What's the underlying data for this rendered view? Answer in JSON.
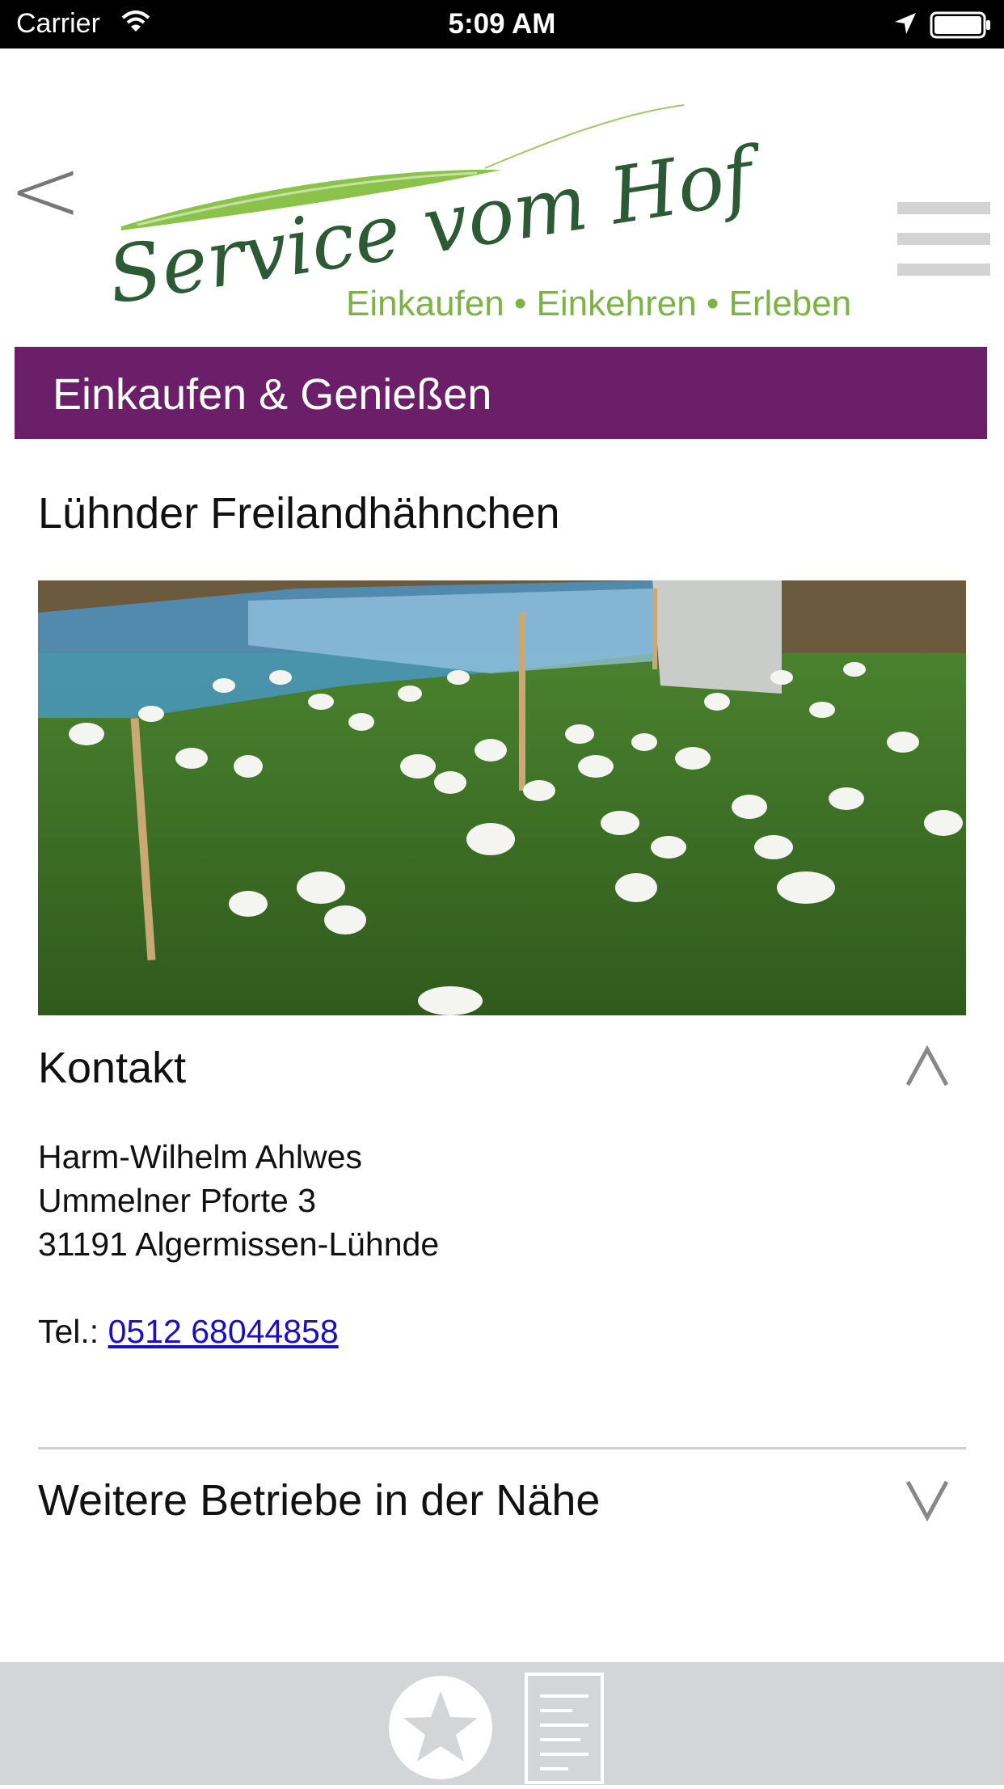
{
  "status_bar": {
    "carrier": "Carrier",
    "time": "5:09 AM",
    "icons": [
      "wifi-icon",
      "location-arrow-icon",
      "battery-icon"
    ]
  },
  "header": {
    "back_label": "<",
    "logo": {
      "line1": "Service vom Hof",
      "tagline": "Einkaufen • Einkehren • Erleben",
      "colors": {
        "script": "#2b5a34",
        "tagline": "#7cb342",
        "leaf": "#8bc34a"
      }
    },
    "menu_icon": "hamburger-menu-icon"
  },
  "category": {
    "label": "Einkaufen & Genießen",
    "color": "#6a1f68"
  },
  "listing": {
    "title": "Lühnder Freilandhähnchen",
    "photo_icon": "chicken-farm-photo"
  },
  "contact": {
    "heading": "Kontakt",
    "expanded_icon": "chevron-up-icon",
    "name": "Harm-Wilhelm Ahlwes",
    "street": "Ummelner Pforte 3",
    "city": "31191 Algermissen-Lühnde",
    "phone_label": "Tel.:",
    "phone": "0512 68044858",
    "link_color": "#1a0dcc"
  },
  "nearby": {
    "heading": "Weitere Betriebe in der Nähe",
    "collapsed_icon": "chevron-down-icon"
  },
  "toolbar": {
    "favorite_icon": "star-icon",
    "document_icon": "document-icon",
    "background": "#d4d5d7"
  }
}
